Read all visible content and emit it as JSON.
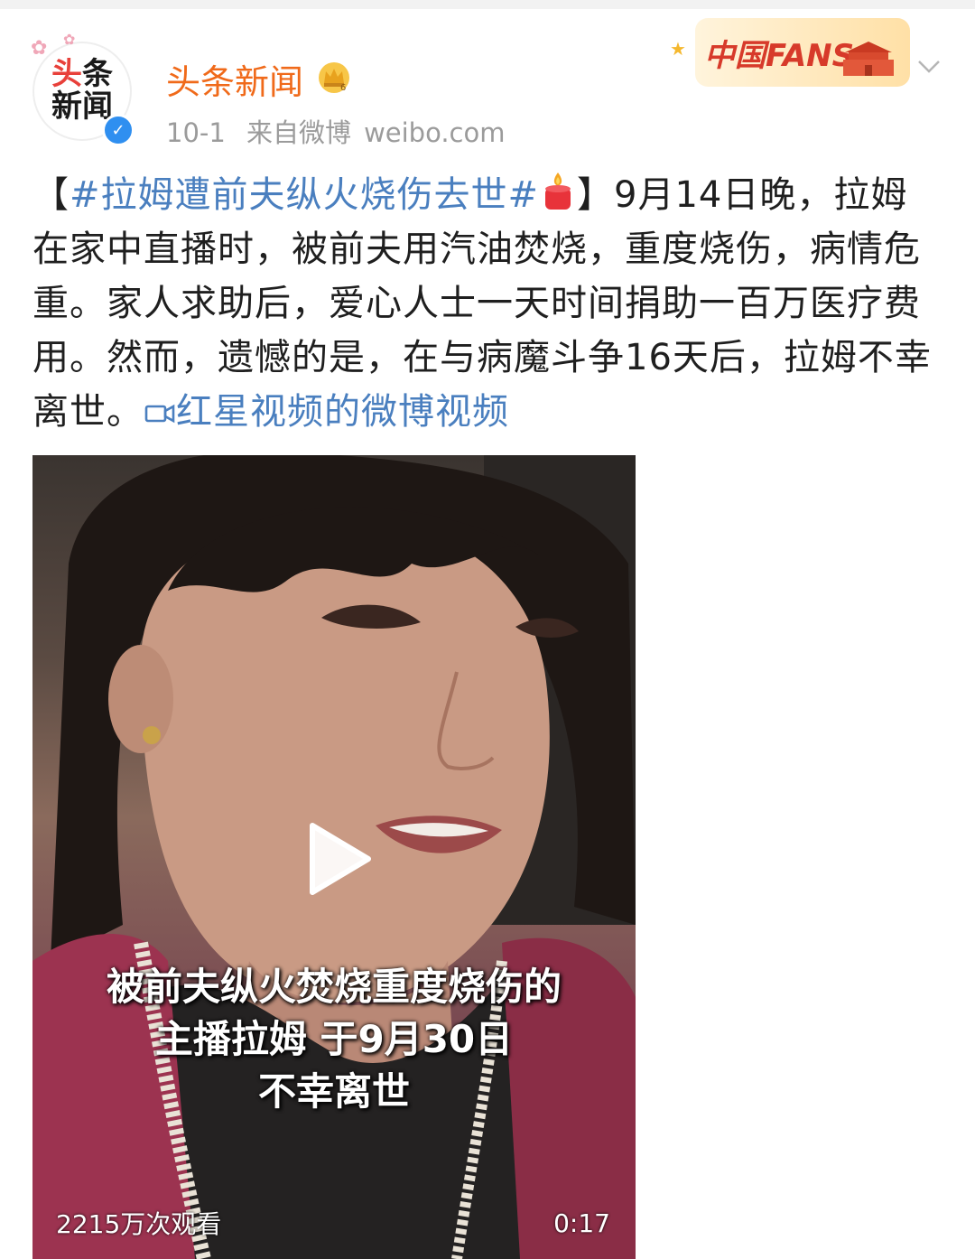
{
  "account": {
    "name": "头条新闻",
    "avatar_line1_a": "头",
    "avatar_line1_b": "条",
    "avatar_line2": "新闻",
    "verify_mark": "✓",
    "crown_icon": "crown-icon"
  },
  "meta": {
    "date": "10-1",
    "source": "来自微博",
    "domain": "weibo.com"
  },
  "badge": {
    "text": "中国FANS"
  },
  "post": {
    "bracket_open": "【",
    "hashtag": "#拉姆遭前夫纵火烧伤去世#",
    "bracket_close": "】",
    "body": "9月14日晚，拉姆在家中直播时，被前夫用汽油焚烧，重度烧伤，病情危重。家人求助后，爱心人士一天时间捐助一百万医疗费用。然而，遗憾的是，在与病魔斗争16天后，拉姆不幸离世。",
    "video_link": "红星视频的微博视频"
  },
  "video": {
    "caption_line1": "被前夫纵火焚烧重度烧伤的",
    "caption_line2": "主播拉姆  于9月30日",
    "caption_line3": "不幸离世",
    "views": "2215万次观看",
    "duration": "0:17"
  },
  "colors": {
    "name": "#f06a1a",
    "link": "#4a7fbf",
    "meta": "#9b9b9b",
    "verify": "#2f8ff0"
  }
}
